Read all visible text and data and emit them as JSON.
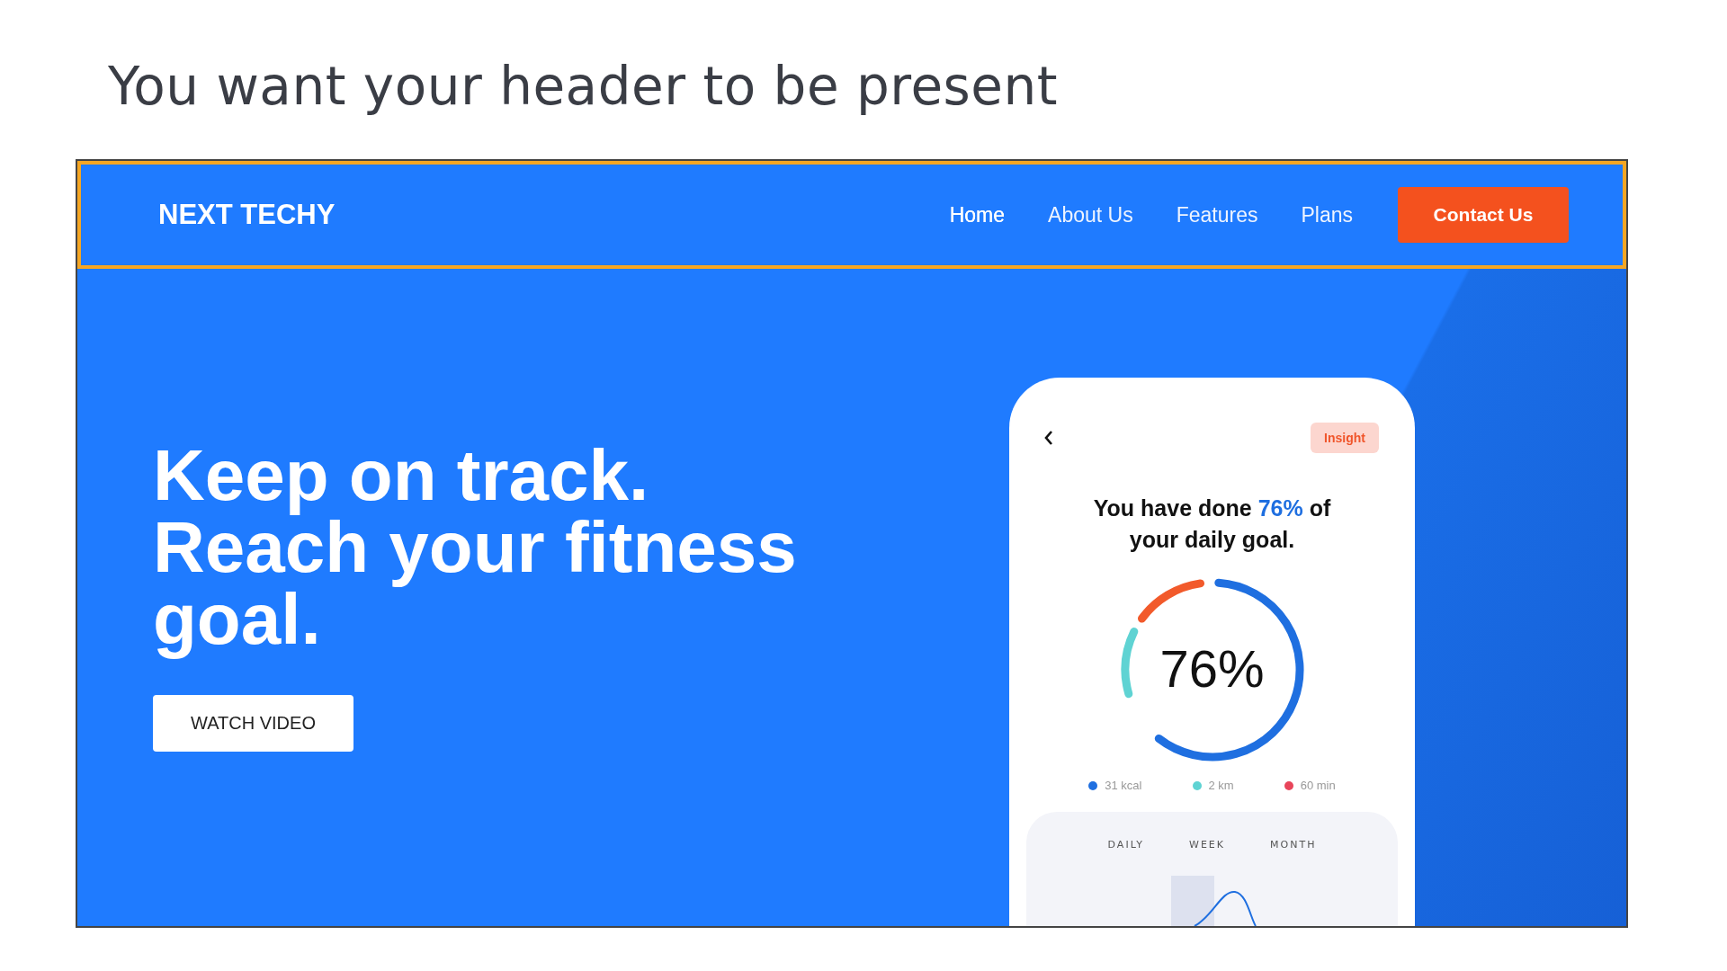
{
  "slide_title": "You want your header to be present",
  "header": {
    "logo": "NEXT TECHY",
    "highlighted": true,
    "nav": [
      {
        "label": "Home",
        "selected": true
      },
      {
        "label": "About Us",
        "selected": false
      },
      {
        "label": "Features",
        "selected": false
      },
      {
        "label": "Plans",
        "selected": false
      }
    ],
    "cta": "Contact Us"
  },
  "hero": {
    "headline": [
      "Keep on track.",
      "Reach your fitness goal."
    ],
    "button": "WATCH VIDEO"
  },
  "phone": {
    "badge": "Insight",
    "message": "You have done **76%** of your daily goal.",
    "ring_value": "76%",
    "legend": [
      {
        "label": "31 kcal",
        "color": "#1f6fe0"
      },
      {
        "label": "2 km",
        "color": "#5fd3d3"
      },
      {
        "label": "60 min",
        "color": "#e8455a"
      }
    ],
    "tabs": [
      "DAILY",
      "WEEK",
      "MONTH"
    ]
  }
}
